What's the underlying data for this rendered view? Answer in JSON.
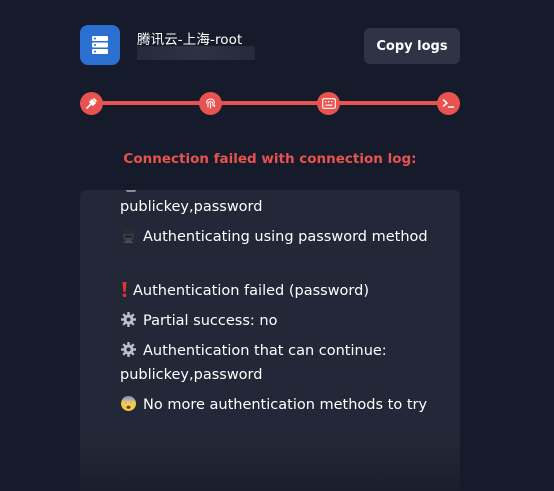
{
  "header": {
    "title": "腾讯云-上海-root",
    "copy_logs_label": "Copy logs"
  },
  "colors": {
    "accent_red": "#e8524f",
    "background": "#151b2a",
    "log_background": "#232838",
    "host_icon": "#2b6fd1"
  },
  "stepper": {
    "steps": [
      {
        "icon": "plug-icon"
      },
      {
        "icon": "fingerprint-icon"
      },
      {
        "icon": "keyboard-icon"
      },
      {
        "icon": "terminal-icon"
      }
    ]
  },
  "error": {
    "title": "Connection failed with connection log:"
  },
  "log": {
    "lines": [
      {
        "icon": null,
        "text": "publickey,password"
      },
      {
        "icon": "spy-emoji-icon",
        "text": "Authenticating using password method"
      },
      {
        "icon": "exclamation-icon",
        "text": "Authentication failed (password)"
      },
      {
        "icon": "gear-icon",
        "text": "Partial success: no"
      },
      {
        "icon": "gear-icon",
        "text": "Authentication that can continue: publickey,password"
      },
      {
        "icon": "fearful-face-icon",
        "text": "No more authentication methods to try"
      }
    ]
  }
}
